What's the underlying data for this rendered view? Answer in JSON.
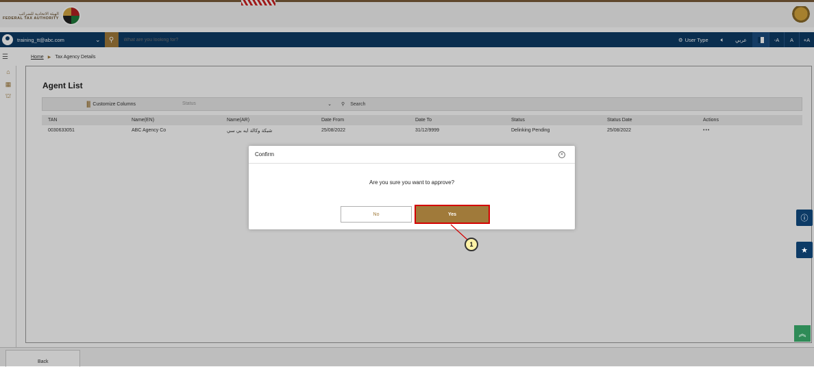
{
  "header": {
    "logo_ar": "الهيئة الاتحادية للضرائب",
    "logo_en": "FEDERAL TAX AUTHORITY"
  },
  "userbar": {
    "email": "training_tt@abc.com",
    "search_placeholder": "What are you looking for?",
    "user_type_label": "User Type",
    "language_label": "عربي",
    "font_small": "-A",
    "font_normal": "A",
    "font_large": "+A"
  },
  "breadcrumb": {
    "home": "Home",
    "current": "Tax Agency Details"
  },
  "panel": {
    "title": "Agent List",
    "customize_label": "Customize Columns",
    "status_placeholder": "Status",
    "search_label": "Search",
    "columns": [
      "TAN",
      "Name(EN)",
      "Name(AR)",
      "Date From",
      "Date To",
      "Status",
      "Status Date",
      "Actions"
    ],
    "rows": [
      {
        "tan": "0030633051",
        "name_en": "ABC Agency Co",
        "name_ar": "شبكة وكالة ايه بي سي",
        "date_from": "25/08/2022",
        "date_to": "31/12/9999",
        "status": "Delinking Pending",
        "status_date": "25/08/2022",
        "actions": "•••"
      }
    ]
  },
  "dialog": {
    "title": "Confirm",
    "message": "Are you sure you want to approve?",
    "no_label": "No",
    "yes_label": "Yes"
  },
  "callout": {
    "number": "1"
  },
  "footer": {
    "back_label": "Back"
  },
  "colors": {
    "brand_gold": "#a07a3a",
    "navy": "#0d3b66",
    "highlight_red": "#d40000"
  }
}
